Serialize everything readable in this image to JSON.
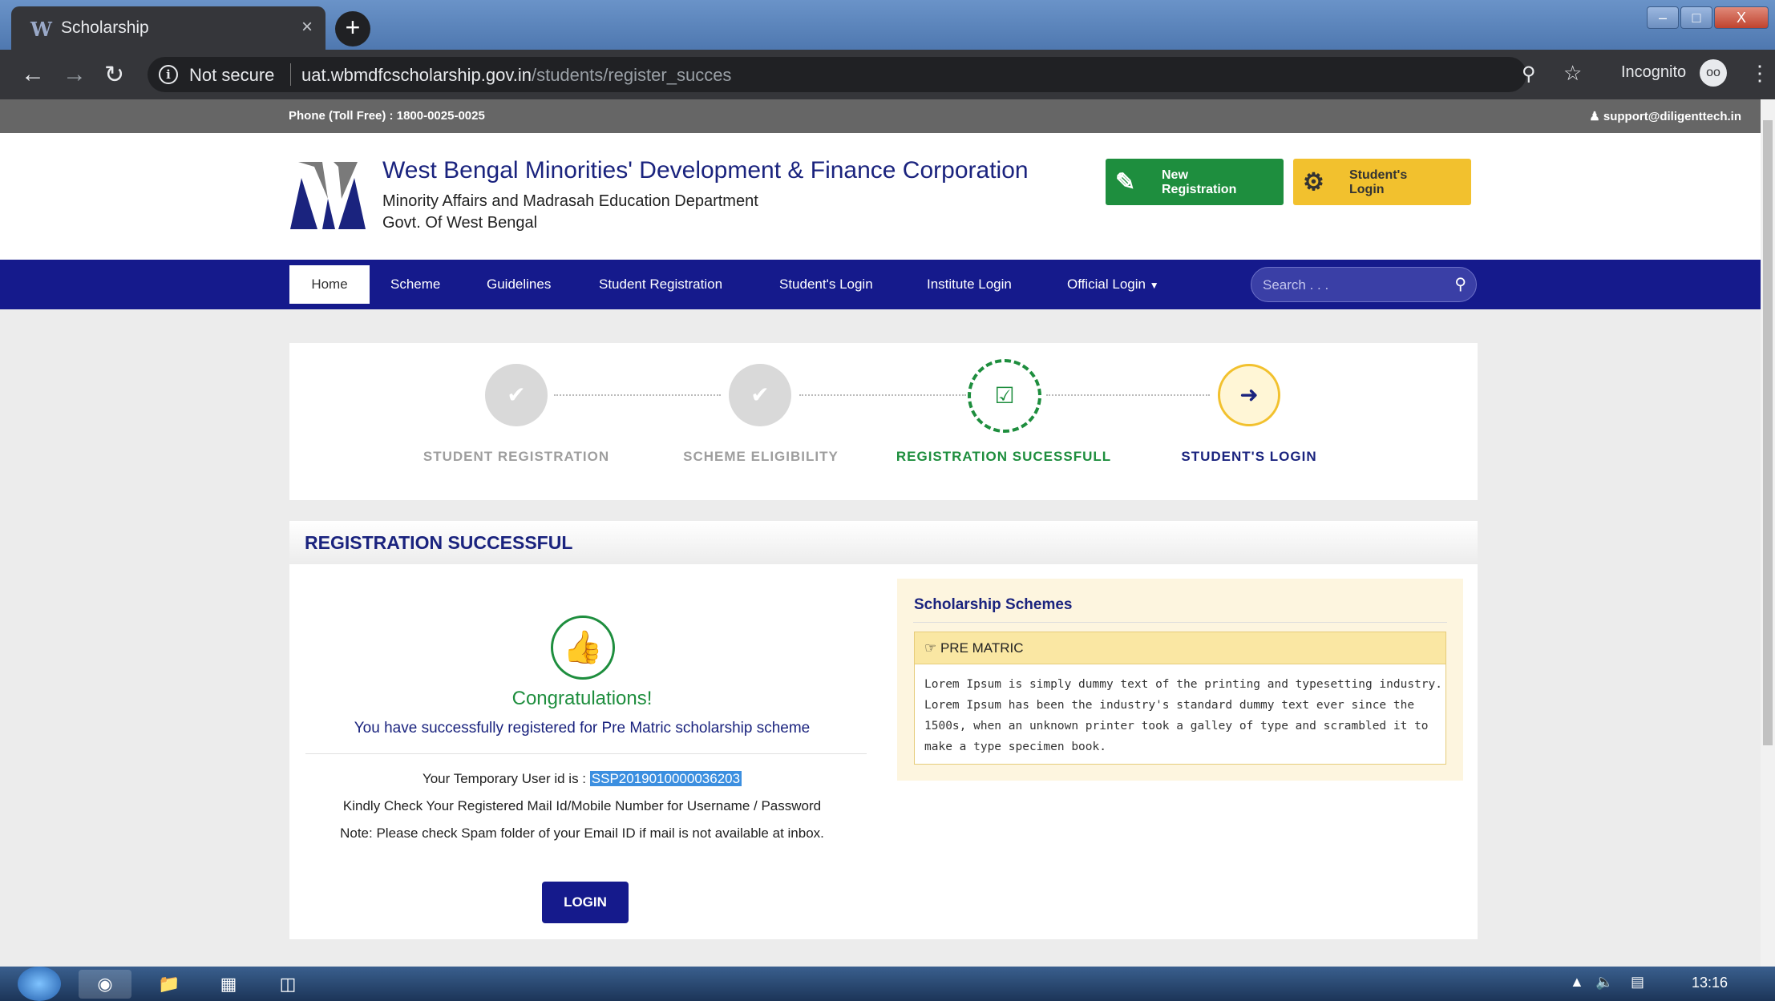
{
  "browser": {
    "tab_title": "Scholarship",
    "tab_close": "×",
    "new_tab": "+",
    "security": "Not secure",
    "url_host": "uat.wbmdfcscholarship.gov.in",
    "url_path": "/students/register_succes",
    "profile": "Incognito",
    "window_buttons": [
      "–",
      "□",
      "X"
    ]
  },
  "topbar": {
    "phone": "Phone (Toll Free) : 1800-0025-0025",
    "email": "support@diligenttech.in"
  },
  "header": {
    "org_name": "West Bengal Minorities' Development & Finance Corporation",
    "dept": "Minority Affairs and Madrasah Education Department",
    "govt": "Govt. Of West Bengal",
    "new_registration": "New Registration",
    "students_login": "Student's Login"
  },
  "nav": {
    "items": [
      "Home",
      "Scheme",
      "Guidelines",
      "Student Registration",
      "Student's Login",
      "Institute Login",
      "Official Login"
    ],
    "search_placeholder": "Search . . ."
  },
  "steps": [
    {
      "label": "STUDENT REGISTRATION",
      "state": "done",
      "icon": "check-icon"
    },
    {
      "label": "SCHEME ELIGIBILITY",
      "state": "done",
      "icon": "check-icon"
    },
    {
      "label": "REGISTRATION SUCESSFULL",
      "state": "active",
      "icon": "check-square-icon"
    },
    {
      "label": "STUDENT'S LOGIN",
      "state": "next",
      "icon": "sign-in-icon"
    }
  ],
  "result": {
    "heading": "REGISTRATION SUCCESSFUL",
    "congrats": "Congratulations!",
    "message": "You have successfully registered for Pre Matric scholarship scheme",
    "temp_id_label": "Your Temporary User id is :",
    "temp_id": "SSP2019010000036203",
    "check_mail": "Kindly Check Your Registered Mail Id/Mobile Number for Username / Password",
    "note": "Note: Please check Spam folder of your Email ID if mail is not available at inbox.",
    "login_button": "LOGIN"
  },
  "schemes": {
    "title": "Scholarship Schemes",
    "item_title": "PRE MATRIC",
    "item_body": "Lorem Ipsum is simply dummy text of the printing and typesetting industry. Lorem Ipsum has been the industry's standard dummy text ever since the 1500s, when an unknown printer took a galley of type and scrambled it to make a type specimen book."
  },
  "taskbar": {
    "clock": "13:16"
  },
  "colors": {
    "nav_bg": "#151a8c",
    "accent_green": "#1e8e3e",
    "accent_yellow": "#f2c12e",
    "title_blue": "#1a237e"
  }
}
